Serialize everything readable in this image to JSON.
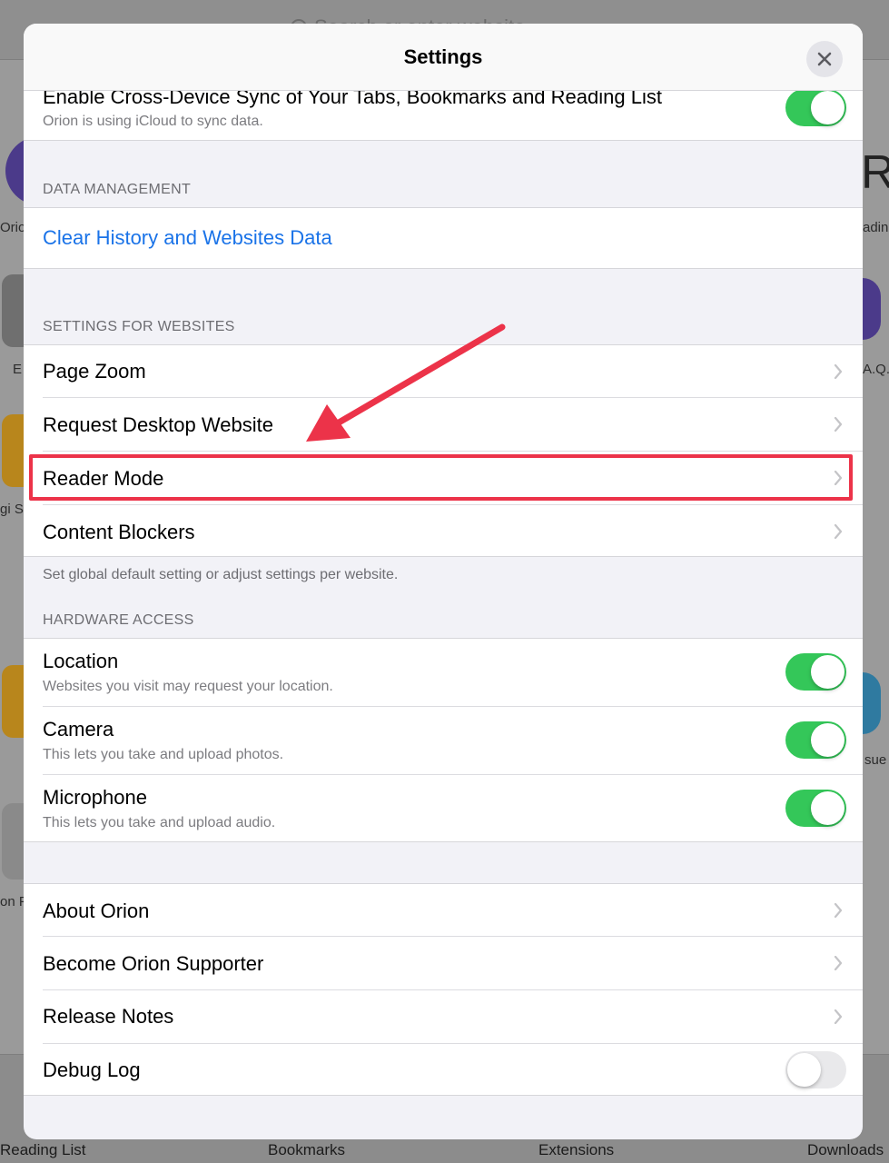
{
  "background": {
    "search_placeholder": "Search or enter website",
    "left_labels": [
      "Orio",
      "E",
      "gi Se",
      "on F"
    ],
    "right_labels": [
      "adin",
      "A.Q.",
      "sue T"
    ],
    "right_glyph": "R",
    "bottom_tabs": [
      "Reading List",
      "Bookmarks",
      "Extensions",
      "Downloads"
    ]
  },
  "sheet": {
    "title": "Settings",
    "close_label": "close"
  },
  "sync": {
    "title": "Enable Cross-Device Sync of Your Tabs, Bookmarks and Reading List",
    "subtitle": "Orion is using iCloud to sync data.",
    "enabled": true
  },
  "data_management": {
    "header": "DATA MANAGEMENT",
    "clear_label": "Clear History and Websites Data"
  },
  "settings_for_websites": {
    "header": "SETTINGS FOR WEBSITES",
    "items": [
      "Page Zoom",
      "Request Desktop Website",
      "Reader Mode",
      "Content Blockers"
    ],
    "footer": "Set global default setting or adjust settings per website."
  },
  "hardware_access": {
    "header": "HARDWARE ACCESS",
    "items": [
      {
        "title": "Location",
        "subtitle": "Websites you visit may request your location.",
        "enabled": true
      },
      {
        "title": "Camera",
        "subtitle": "This lets you take and upload photos.",
        "enabled": true
      },
      {
        "title": "Microphone",
        "subtitle": "This lets you take and upload audio.",
        "enabled": true
      }
    ]
  },
  "about": {
    "items": [
      "About Orion",
      "Become Orion Supporter",
      "Release Notes"
    ],
    "debug_log": {
      "title": "Debug Log",
      "enabled": false
    }
  },
  "colors": {
    "accent_blue": "#1a73e8",
    "toggle_on": "#34c759",
    "annotation_red": "#ec3349"
  },
  "annotation": {
    "highlighted_item": "Reader Mode"
  }
}
